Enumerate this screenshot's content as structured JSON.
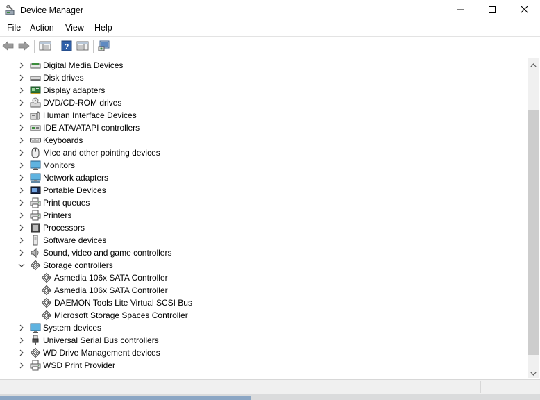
{
  "window": {
    "title": "Device Manager",
    "minimize_icon": "minimize-icon",
    "maximize_icon": "maximize-icon",
    "close_icon": "close-icon"
  },
  "menu": {
    "items": [
      {
        "label": "File"
      },
      {
        "label": "Action"
      },
      {
        "label": "View"
      },
      {
        "label": "Help"
      }
    ]
  },
  "toolbar": {
    "buttons": [
      "back-arrow-icon",
      "forward-arrow-icon",
      "show-hide-console-tree-icon",
      "help-icon",
      "properties-icon",
      "scan-hardware-changes-icon"
    ]
  },
  "tree": {
    "items": [
      {
        "label": "Digital Media Devices",
        "icon": "media-device-icon",
        "level": 0,
        "expanded": false
      },
      {
        "label": "Disk drives",
        "icon": "disk-drive-icon",
        "level": 0,
        "expanded": false
      },
      {
        "label": "Display adapters",
        "icon": "display-adapter-icon",
        "level": 0,
        "expanded": false
      },
      {
        "label": "DVD/CD-ROM drives",
        "icon": "dvd-drive-icon",
        "level": 0,
        "expanded": false
      },
      {
        "label": "Human Interface Devices",
        "icon": "hid-icon",
        "level": 0,
        "expanded": false
      },
      {
        "label": "IDE ATA/ATAPI controllers",
        "icon": "ide-controller-icon",
        "level": 0,
        "expanded": false
      },
      {
        "label": "Keyboards",
        "icon": "keyboard-icon",
        "level": 0,
        "expanded": false
      },
      {
        "label": "Mice and other pointing devices",
        "icon": "mouse-icon",
        "level": 0,
        "expanded": false
      },
      {
        "label": "Monitors",
        "icon": "monitor-icon",
        "level": 0,
        "expanded": false
      },
      {
        "label": "Network adapters",
        "icon": "network-adapter-icon",
        "level": 0,
        "expanded": false
      },
      {
        "label": "Portable Devices",
        "icon": "portable-device-icon",
        "level": 0,
        "expanded": false
      },
      {
        "label": "Print queues",
        "icon": "printer-icon",
        "level": 0,
        "expanded": false
      },
      {
        "label": "Printers",
        "icon": "printer-icon",
        "level": 0,
        "expanded": false
      },
      {
        "label": "Processors",
        "icon": "processor-icon",
        "level": 0,
        "expanded": false
      },
      {
        "label": "Software devices",
        "icon": "software-device-icon",
        "level": 0,
        "expanded": false
      },
      {
        "label": "Sound, video and game controllers",
        "icon": "speaker-icon",
        "level": 0,
        "expanded": false
      },
      {
        "label": "Storage controllers",
        "icon": "storage-controller-icon",
        "level": 0,
        "expanded": true
      },
      {
        "label": "Asmedia 106x SATA Controller",
        "icon": "storage-controller-icon",
        "level": 1
      },
      {
        "label": "Asmedia 106x SATA Controller",
        "icon": "storage-controller-icon",
        "level": 1
      },
      {
        "label": "DAEMON Tools Lite Virtual SCSI Bus",
        "icon": "storage-controller-icon",
        "level": 1
      },
      {
        "label": "Microsoft Storage Spaces Controller",
        "icon": "storage-controller-icon",
        "level": 1
      },
      {
        "label": "System devices",
        "icon": "system-device-icon",
        "level": 0,
        "expanded": false
      },
      {
        "label": "Universal Serial Bus controllers",
        "icon": "usb-icon",
        "level": 0,
        "expanded": false
      },
      {
        "label": "WD Drive Management devices",
        "icon": "storage-controller-icon",
        "level": 0,
        "expanded": false
      },
      {
        "label": "WSD Print Provider",
        "icon": "printer-icon",
        "level": 0,
        "expanded": false
      }
    ]
  }
}
